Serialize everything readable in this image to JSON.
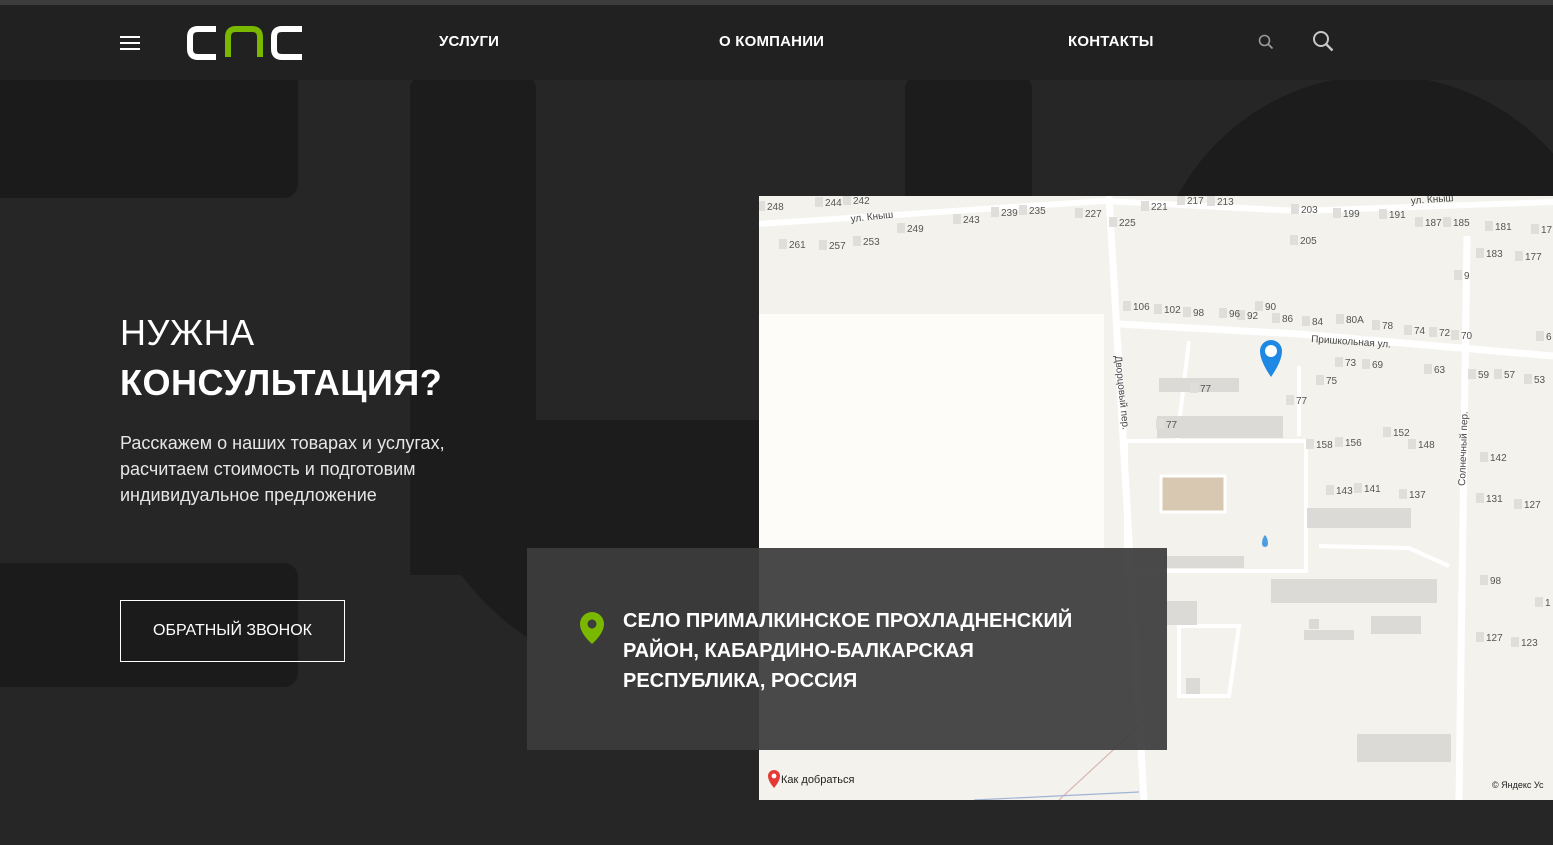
{
  "header": {
    "logo_text": "CNC",
    "nav": [
      "УСЛУГИ",
      "О КОМПАНИИ",
      "КОНТАКТЫ"
    ],
    "accent_color": "#7ab800"
  },
  "hero": {
    "title_line1": "НУЖНА",
    "title_line2": "КОНСУЛЬТАЦИЯ?",
    "description": "Расскажем о наших товарах и услугах, расчитаем стоимость и подготовим индивидуальное предложение",
    "callback_button": "ОБРАТНЫЙ ЗВОНОК"
  },
  "address": {
    "text": "СЕЛО ПРИМАЛКИНСКОЕ ПРОХЛАДНЕНСКИЙ РАЙОН, КАБАРДИНО-БАЛКАРСКАЯ РЕСПУБЛИКА, РОССИЯ"
  },
  "map": {
    "route_label": "Как добраться",
    "copyright": "© Яндекс  Ус",
    "streets": [
      "ул. Кныш",
      "ул. Кныш",
      "Пришкольная ул.",
      "Дворцовый пер.",
      "Солнечный пер."
    ],
    "house_numbers": [
      "248",
      "244",
      "242",
      "249",
      "243",
      "239",
      "235",
      "227",
      "225",
      "221",
      "217",
      "213",
      "203",
      "199",
      "191",
      "187",
      "185",
      "181",
      "17",
      "261",
      "257",
      "253",
      "205",
      "183",
      "177",
      "9",
      "106",
      "102",
      "98",
      "96",
      "92",
      "90",
      "86",
      "84",
      "80А",
      "78",
      "74",
      "72",
      "70",
      "6",
      "77",
      "77",
      "77",
      "75",
      "73",
      "69",
      "63",
      "59",
      "57",
      "53",
      "158",
      "156",
      "152",
      "148",
      "142",
      "143",
      "141",
      "137",
      "131",
      "127",
      "98",
      "127",
      "123",
      "1"
    ]
  }
}
